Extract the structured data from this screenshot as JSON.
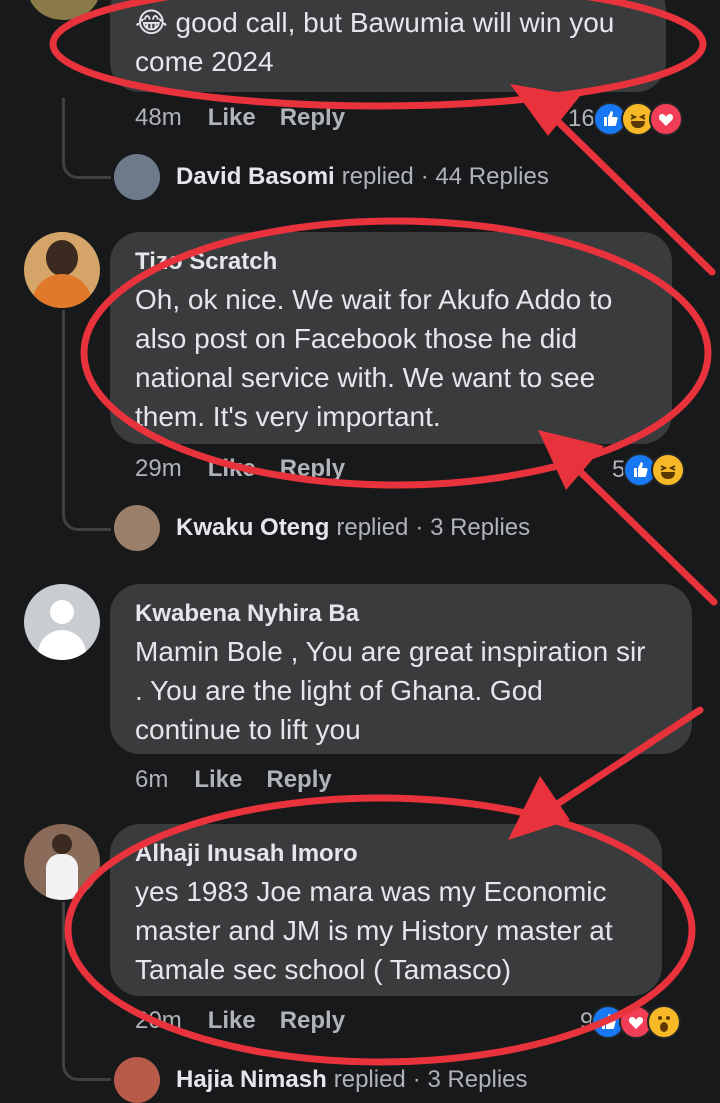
{
  "comments": [
    {
      "author": "",
      "text": "😂 good call, but Bawumia will win you\ncome 2024",
      "time": "48m",
      "like": "Like",
      "reply": "Reply",
      "reactions_count": "16",
      "reactions": [
        "like-icon",
        "haha-icon",
        "love-icon"
      ],
      "replied_by": "David Basomi",
      "replied_word": "replied",
      "replies": "· 44 Replies"
    },
    {
      "author": "Tizo Scratch",
      "text": "Oh,  ok nice. We wait for Akufo Addo to\nalso post on Facebook those he did\nnational service with.  We  want to see\nthem. It's very important.",
      "time": "29m",
      "like": "Like",
      "reply": "Reply",
      "reactions_count": "5",
      "reactions": [
        "like-icon",
        "haha-icon"
      ],
      "replied_by": "Kwaku Oteng",
      "replied_word": "replied",
      "replies": "· 3 Replies"
    },
    {
      "author": "Kwabena Nyhira Ba",
      "text": "Mamin Bole , You are great inspiration sir\n. You are the light of Ghana. God\ncontinue to lift you",
      "time": "6m",
      "like": "Like",
      "reply": "Reply"
    },
    {
      "author": "Alhaji Inusah Imoro",
      "text": "yes 1983 Joe mara was my Economic\nmaster and JM is my History master at\nTamale sec school ( Tamasco)",
      "time": "20m",
      "like": "Like",
      "reply": "Reply",
      "reactions_count": "9",
      "reactions": [
        "like-icon",
        "love-icon",
        "wow-icon"
      ],
      "replied_by": "Hajia Nimash",
      "replied_word": "replied",
      "replies": "· 3 Replies"
    }
  ],
  "colors": {
    "background": "#18191a",
    "bubble": "#3a3b3c",
    "annotation_red": "#e8323c",
    "like_blue": "#1877f2",
    "love_red": "#f33e58",
    "haha_yellow": "#f7b928"
  }
}
